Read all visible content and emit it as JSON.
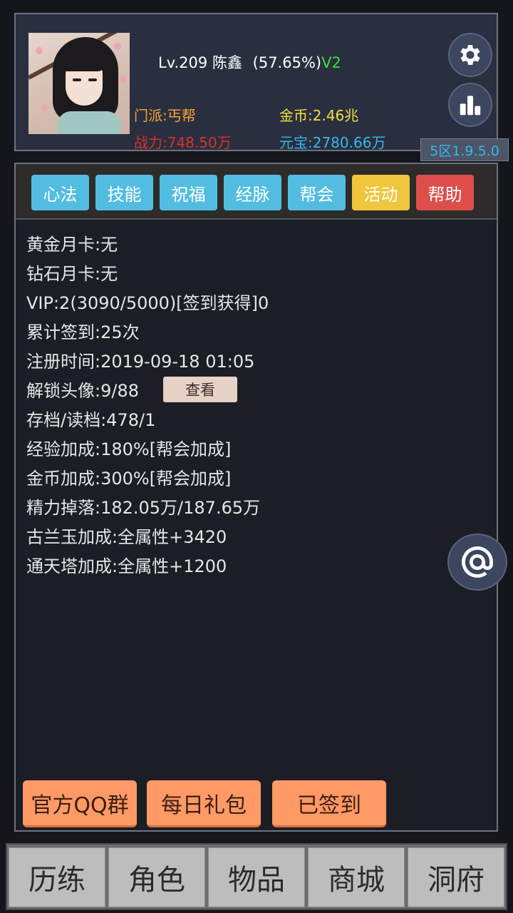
{
  "player": {
    "level": "Lv.209",
    "name": "陈鑫",
    "exp_percent": "(57.65%)",
    "vip_tag": "V2",
    "sect": "门派:丐帮",
    "gold": "金币:2.46兆",
    "power": "战力:748.50万",
    "yuanbao": "元宝:2780.66万",
    "server": "5区1.9.5.0"
  },
  "icons": {
    "settings": "gear-icon",
    "stats": "bar-chart-icon",
    "contact": "at-sign-icon"
  },
  "tabs": [
    {
      "label": "心法",
      "color": "#52bde0"
    },
    {
      "label": "技能",
      "color": "#52bde0"
    },
    {
      "label": "祝福",
      "color": "#52bde0"
    },
    {
      "label": "经脉",
      "color": "#52bde0"
    },
    {
      "label": "帮会",
      "color": "#52bde0"
    },
    {
      "label": "活动",
      "color": "#f0c63c"
    },
    {
      "label": "帮助",
      "color": "#dd4e4a"
    }
  ],
  "info": [
    "黄金月卡:无",
    "钻石月卡:无",
    "VIP:2(3090/5000)[签到获得]0",
    "累计签到:25次",
    "注册时间:2019-09-18 01:05",
    "解锁头像:9/88",
    "存档/读档:478/1",
    "经验加成:180%[帮会加成]",
    "金币加成:300%[帮会加成]",
    "精力掉落:182.05万/187.65万",
    "古兰玉加成:全属性+3420",
    "通天塔加成:全属性+1200"
  ],
  "view_button": "查看",
  "actions": {
    "qq_group": "官方QQ群",
    "daily_gift": "每日礼包",
    "signed_in": "已签到"
  },
  "nav": [
    "历练",
    "角色",
    "物品",
    "商城",
    "洞府"
  ]
}
